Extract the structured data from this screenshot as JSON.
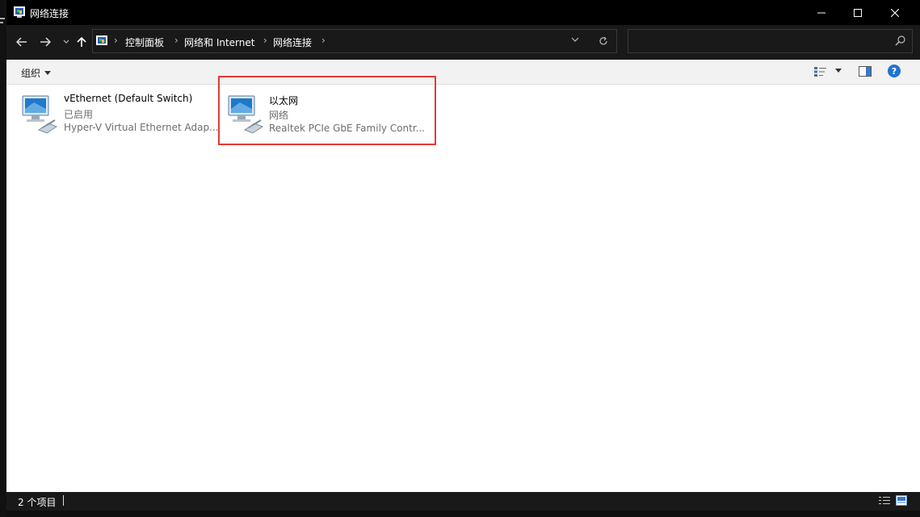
{
  "window": {
    "title": "网络连接"
  },
  "address": {
    "crumbs": [
      "控制面板",
      "网络和 Internet",
      "网络连接"
    ],
    "search_placeholder": ""
  },
  "toolbar": {
    "organize_label": "组织"
  },
  "connections": [
    {
      "name": "vEthernet (Default Switch)",
      "status": "已启用",
      "device": "Hyper-V Virtual Ethernet Adap...",
      "icon": "network-adapter-icon"
    },
    {
      "name": "以太网",
      "status": "网络",
      "device": "Realtek PCIe GbE Family Contr...",
      "icon": "network-adapter-icon",
      "highlighted": true
    }
  ],
  "status": {
    "item_count": "2 个项目"
  },
  "colors": {
    "highlight_border": "#e53935",
    "help_blue": "#1e73d2",
    "title_bg": "#000000"
  }
}
